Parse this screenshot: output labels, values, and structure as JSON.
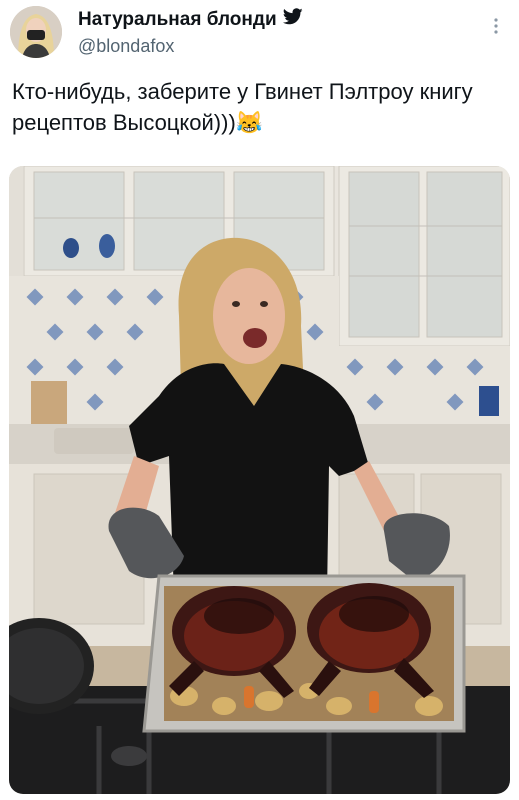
{
  "tweet": {
    "display_name": "Натуральная блонди",
    "handle": "@blondafox",
    "text": "Кто-нибудь, заберите у Гвинет Пэлтроу книгу рецептов Высоцкой)))",
    "emoji": "😹"
  },
  "icons": {
    "verified": "twitter-bird-icon",
    "more": "more-dots-icon"
  },
  "colors": {
    "text": "#0f1419",
    "secondary": "#536471"
  }
}
